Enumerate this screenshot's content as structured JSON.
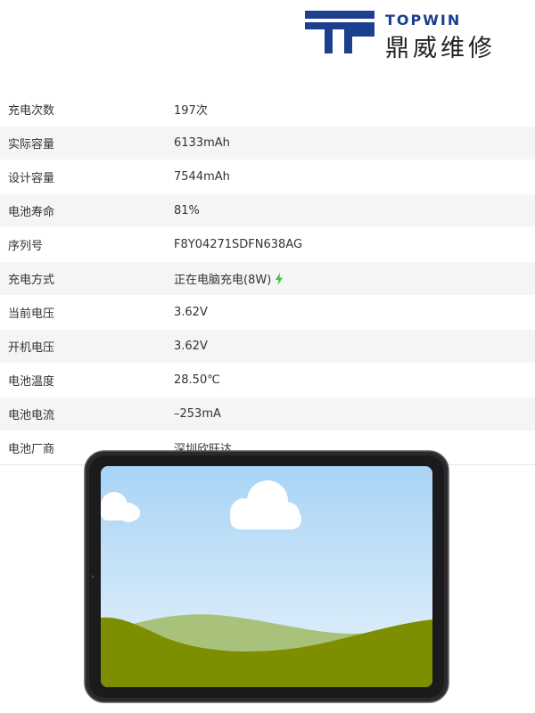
{
  "logo": {
    "brand_en": "TOPWIN",
    "brand_cn": "鼎威维修",
    "colors": {
      "mark": "#1d3f8f"
    }
  },
  "battery_info": [
    {
      "label": "充电次数",
      "value": "197次"
    },
    {
      "label": "实际容量",
      "value": "6133mAh"
    },
    {
      "label": "设计容量",
      "value": "7544mAh"
    },
    {
      "label": "电池寿命",
      "value": "81%"
    },
    {
      "label": "序列号",
      "value": "F8Y04271SDFN638AG"
    },
    {
      "label": "充电方式",
      "value": "正在电脑充电(8W)",
      "icon": "charging-bolt-icon"
    },
    {
      "label": "当前电压",
      "value": "3.62V"
    },
    {
      "label": "开机电压",
      "value": "3.62V"
    },
    {
      "label": "电池温度",
      "value": "28.50℃"
    },
    {
      "label": "电池电流",
      "value": "–253mA"
    },
    {
      "label": "电池厂商",
      "value": "深圳欣旺达"
    }
  ],
  "colors": {
    "row_alt": "#f5f5f7",
    "bolt": "#3cc43c",
    "tablet_frame": "#2a2a2c",
    "sky_top": "#a8d4f5",
    "hill_light": "#a9c27b",
    "hill_dark": "#7d8f00"
  }
}
